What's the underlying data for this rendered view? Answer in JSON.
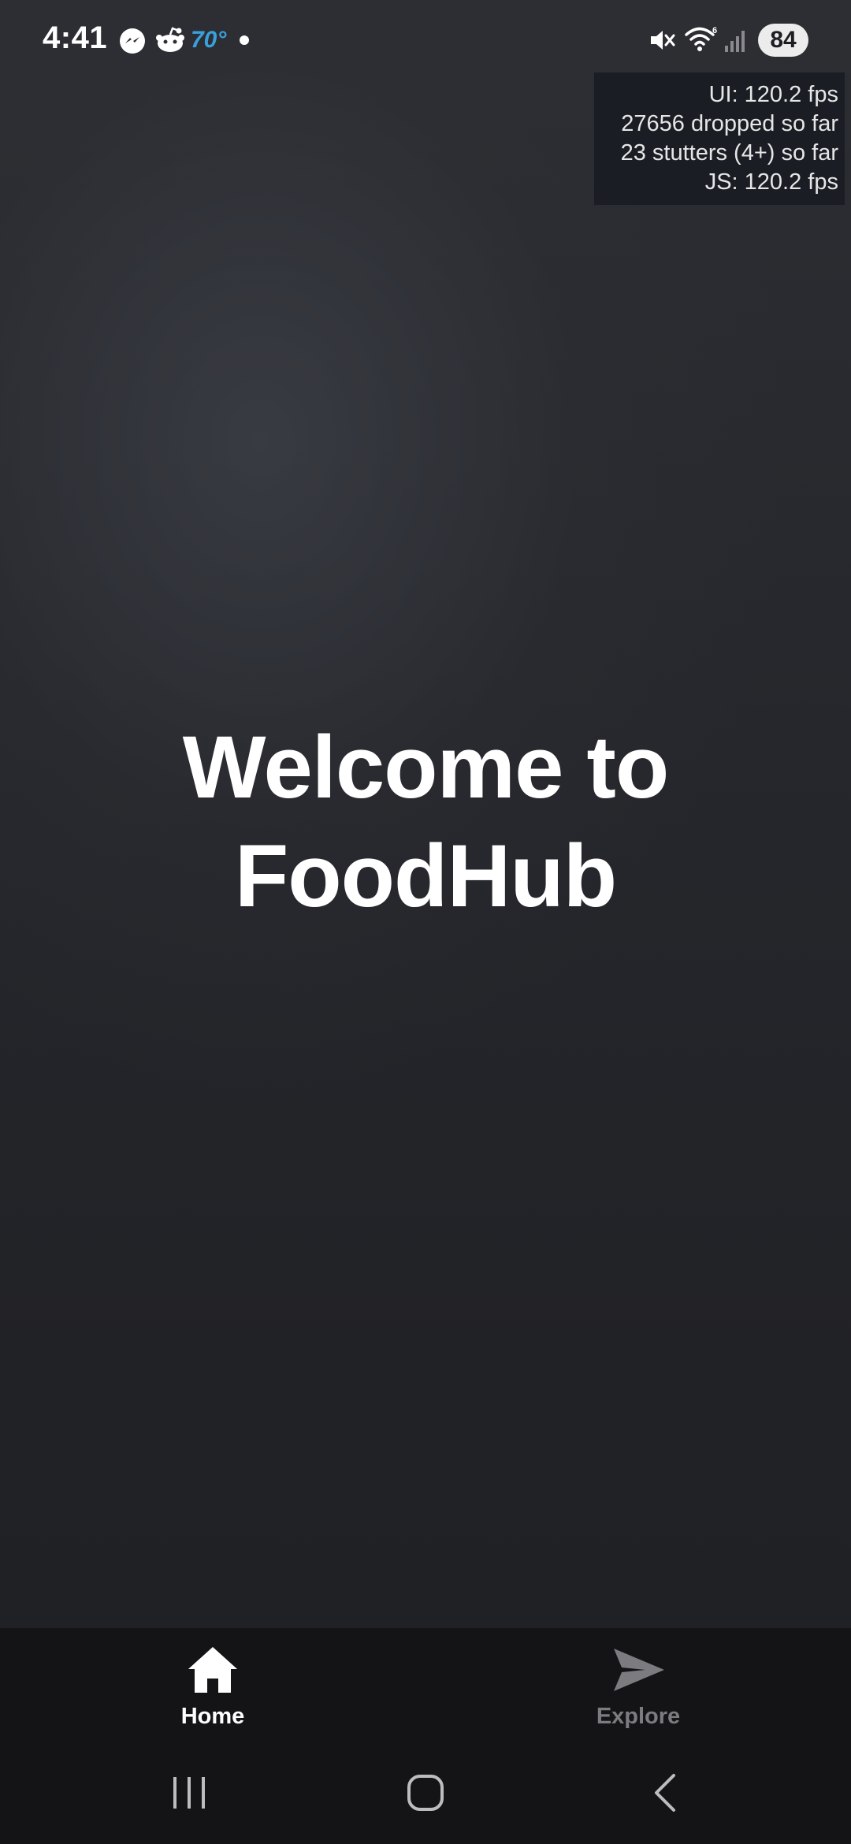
{
  "status_bar": {
    "time": "4:41",
    "temperature": "70°",
    "battery": "84",
    "icons": [
      "messenger-icon",
      "reddit-icon",
      "mute-icon",
      "wifi-icon",
      "signal-icon"
    ]
  },
  "perf_overlay": {
    "ui_fps": "UI: 120.2 fps",
    "dropped": "27656 dropped so far",
    "stutters": "23 stutters (4+) so far",
    "js_fps": "JS: 120.2 fps"
  },
  "main": {
    "title_line1": "Welcome to",
    "title_line2": "FoodHub"
  },
  "tab_bar": {
    "active_tab": "Home",
    "tabs": [
      {
        "label": "Home",
        "icon": "home-icon",
        "active": true
      },
      {
        "label": "Explore",
        "icon": "send-icon",
        "active": false
      }
    ]
  },
  "colors": {
    "background": "#1f2024",
    "tab_bar": "#141416",
    "active_label": "#ffffff",
    "inactive_label": "#7c7c80",
    "temperature": "#3aa0dc"
  },
  "system_nav": {
    "buttons": [
      "recents-icon",
      "home-circle-icon",
      "back-icon"
    ]
  }
}
